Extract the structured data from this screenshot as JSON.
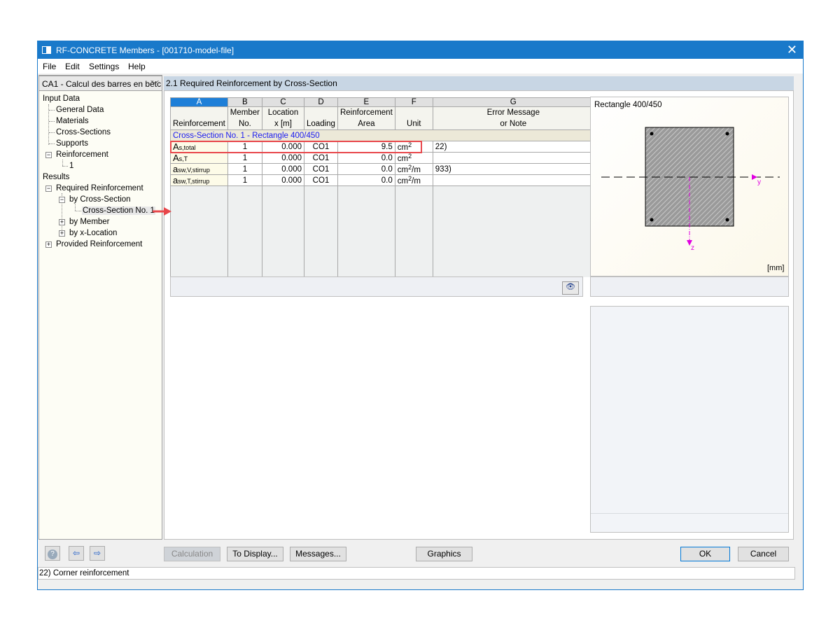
{
  "window": {
    "title": "RF-CONCRETE Members - [001710-model-file]"
  },
  "menu": [
    "File",
    "Edit",
    "Settings",
    "Help"
  ],
  "case_selector": {
    "value": "CA1 - Calcul des barres en bétc"
  },
  "tree": {
    "input_data": "Input Data",
    "general_data": "General Data",
    "materials": "Materials",
    "cross_sections": "Cross-Sections",
    "supports": "Supports",
    "reinforcement": "Reinforcement",
    "reinforcement_1": "1",
    "results": "Results",
    "required_reinforcement": "Required Reinforcement",
    "by_cross_section": "by Cross-Section",
    "cross_section_no_1": "Cross-Section No. 1",
    "by_member": "by Member",
    "by_x_location": "by x-Location",
    "provided_reinforcement": "Provided Reinforcement"
  },
  "main": {
    "title": "2.1 Required Reinforcement by Cross-Section"
  },
  "table": {
    "column_letters": [
      "A",
      "B",
      "C",
      "D",
      "E",
      "F",
      "G"
    ],
    "headers": [
      [
        "",
        "Reinforcement"
      ],
      [
        "Member",
        "No."
      ],
      [
        "Location",
        "x [m]"
      ],
      [
        "",
        "Loading"
      ],
      [
        "Reinforcement",
        "Area"
      ],
      [
        "",
        "Unit"
      ],
      [
        "Error Message",
        "or Note"
      ]
    ],
    "group": "Cross-Section No. 1 - Rectangle 400/450",
    "rows": [
      {
        "sym": "A",
        "sub": "s,total",
        "member": "1",
        "x": "0.000",
        "loading": "CO1",
        "area": "9.5",
        "unit": "cm",
        "unit_sup": "2",
        "unit_suffix": "",
        "note": "22)"
      },
      {
        "sym": "A",
        "sub": "s,T",
        "member": "1",
        "x": "0.000",
        "loading": "CO1",
        "area": "0.0",
        "unit": "cm",
        "unit_sup": "2",
        "unit_suffix": "",
        "note": ""
      },
      {
        "sym": "a",
        "sub": "sw,V,stirrup",
        "member": "1",
        "x": "0.000",
        "loading": "CO1",
        "area": "0.0",
        "unit": "cm",
        "unit_sup": "2",
        "unit_suffix": "/m",
        "note": "933)"
      },
      {
        "sym": "a",
        "sub": "sw,T,stirrup",
        "member": "1",
        "x": "0.000",
        "loading": "CO1",
        "area": "0.0",
        "unit": "cm",
        "unit_sup": "2",
        "unit_suffix": "/m",
        "note": ""
      }
    ]
  },
  "graphic": {
    "title": "Rectangle 400/450",
    "axis_y": "y",
    "axis_z": "z",
    "unit": "[mm]",
    "icon": "eye-icon"
  },
  "buttons": {
    "calculation": "Calculation",
    "to_display": "To Display...",
    "messages": "Messages...",
    "graphics": "Graphics",
    "ok": "OK",
    "cancel": "Cancel"
  },
  "status": "22) Corner reinforcement",
  "colors": {
    "titlebar": "#1979ca",
    "highlight": "#e8474b",
    "axis": "#e000e0",
    "group_text": "#1a1af0"
  }
}
